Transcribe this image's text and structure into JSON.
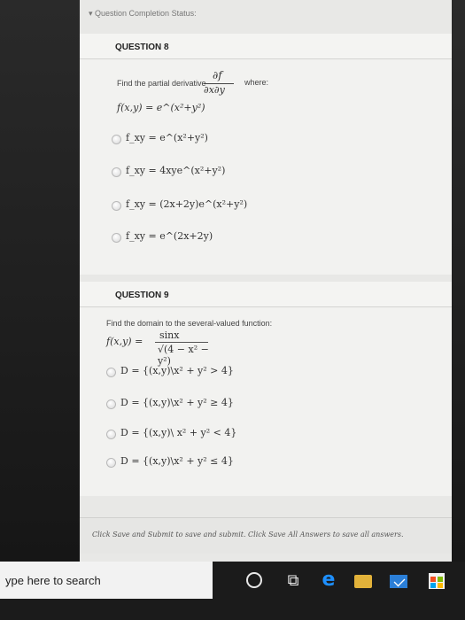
{
  "status": "▾ Question Completion Status:",
  "q8": {
    "title": "QUESTION 8",
    "prompt": "Find the partial derivative",
    "frac_num": "∂f",
    "frac_den": "∂x∂y",
    "where": "where:",
    "function": "f(x,y) = e^(x²+y²)",
    "options": [
      "f_xy = e^(x²+y²)",
      "f_xy = 4xye^(x²+y²)",
      "f_xy = (2x+2y)e^(x²+y²)",
      "f_xy = e^(2x+2y)"
    ]
  },
  "q9": {
    "title": "QUESTION 9",
    "prompt": "Find the domain to the several-valued function:",
    "lhs": "f(x,y) =",
    "num": "sinx",
    "den": "√(4 − x² − y²)",
    "options": [
      "D = {(x,y)\\x² + y² > 4}",
      "D = {(x,y)\\x² + y² ≥ 4}",
      "D = {(x,y)\\ x² + y² < 4}",
      "D = {(x,y)\\x² + y² ≤ 4}"
    ]
  },
  "submit_text": "Click Save and Submit to save and submit. Click Save All Answers to save all answers.",
  "taskbar": {
    "search": "ype here to search"
  }
}
